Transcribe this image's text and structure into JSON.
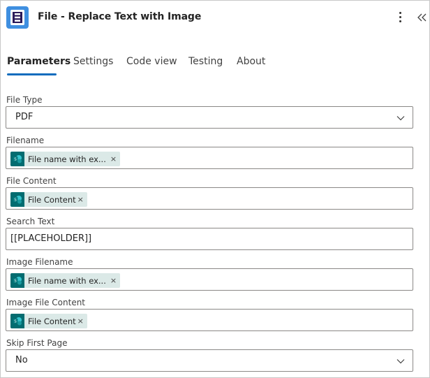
{
  "header": {
    "title": "File - Replace Text with Image",
    "logo_icon": "encodian-logo-icon",
    "more_icon": "more-vertical-icon",
    "collapse_icon": "double-chevron-left-icon"
  },
  "tabs": [
    {
      "label": "Parameters",
      "active": true
    },
    {
      "label": "Settings",
      "active": false
    },
    {
      "label": "Code view",
      "active": false
    },
    {
      "label": "Testing",
      "active": false
    },
    {
      "label": "About",
      "active": false
    }
  ],
  "fields": {
    "file_type": {
      "label": "File Type",
      "value": "PDF"
    },
    "filename": {
      "label": "Filename",
      "token": "File name with ex...",
      "token_close": "×"
    },
    "file_content": {
      "label": "File Content",
      "token": "File Content",
      "token_close": "×"
    },
    "search_text": {
      "label": "Search Text",
      "value": "[[PLACEHOLDER]]"
    },
    "image_filename": {
      "label": "Image Filename",
      "token": "File name with ex...",
      "token_close": "×"
    },
    "image_file_content": {
      "label": "Image File Content",
      "token": "File Content",
      "token_close": "×"
    },
    "skip_first_page": {
      "label": "Skip First Page",
      "value": "No"
    }
  },
  "colors": {
    "accent": "#0f6cbd",
    "logo_bg": "#3f8fe0",
    "token_bg": "#dbe9e7",
    "sharepoint_icon": "#036c70"
  }
}
